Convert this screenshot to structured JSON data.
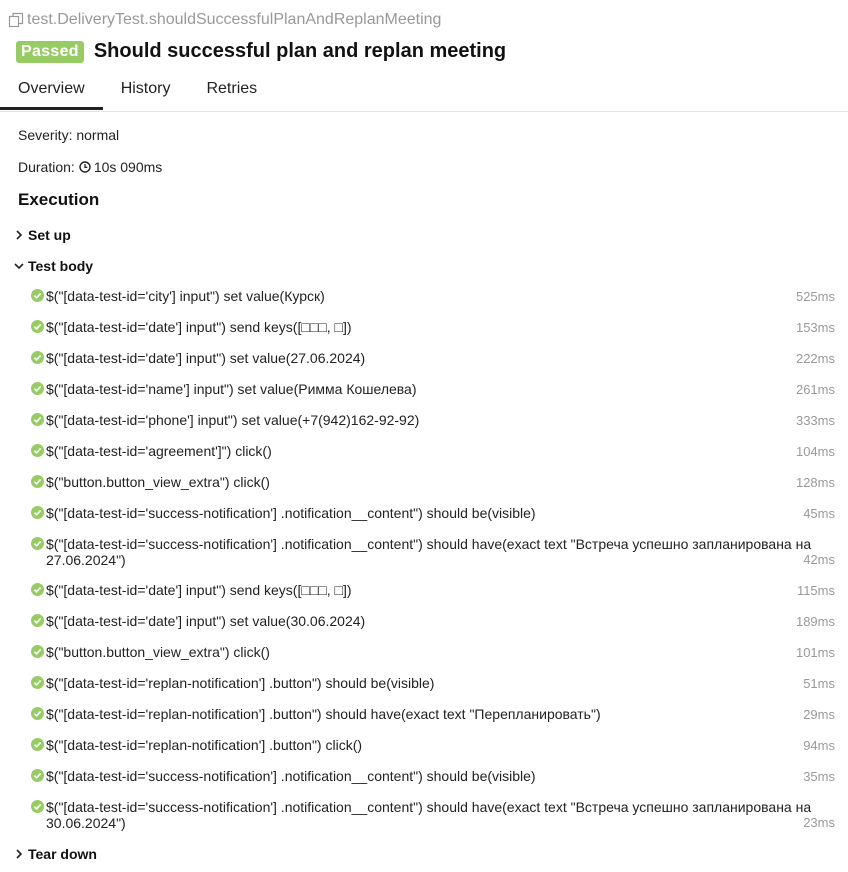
{
  "header": {
    "full_name": "test.DeliveryTest.shouldSuccessfulPlanAndReplanMeeting",
    "status_badge": "Passed",
    "title": "Should successful plan and replan meeting"
  },
  "tabs": [
    {
      "label": "Overview",
      "active": true
    },
    {
      "label": "History",
      "active": false
    },
    {
      "label": "Retries",
      "active": false
    }
  ],
  "severity": {
    "label": "Severity:",
    "value": "normal"
  },
  "duration": {
    "label": "Duration:",
    "value": "10s 090ms"
  },
  "execution": {
    "title": "Execution",
    "set_up_label": "Set up",
    "test_body_label": "Test body",
    "tear_down_label": "Tear down",
    "steps": [
      {
        "name": "$(\"[data-test-id='city'] input\") set value(Курск)",
        "duration": "525ms"
      },
      {
        "name": "$(\"[data-test-id='date'] input\") send keys([□□□, □])",
        "duration": "153ms"
      },
      {
        "name": "$(\"[data-test-id='date'] input\") set value(27.06.2024)",
        "duration": "222ms"
      },
      {
        "name": "$(\"[data-test-id='name'] input\") set value(Римма Кошелева)",
        "duration": "261ms"
      },
      {
        "name": "$(\"[data-test-id='phone'] input\") set value(+7(942)162-92-92)",
        "duration": "333ms"
      },
      {
        "name": "$(\"[data-test-id='agreement']\") click()",
        "duration": "104ms"
      },
      {
        "name": "$(\"button.button_view_extra\") click()",
        "duration": "128ms"
      },
      {
        "name": "$(\"[data-test-id='success-notification'] .notification__content\") should be(visible)",
        "duration": "45ms"
      },
      {
        "name": "$(\"[data-test-id='success-notification'] .notification__content\") should have(exact text \"Встреча успешно запланирована на 27.06.2024\")",
        "duration": "42ms"
      },
      {
        "name": "$(\"[data-test-id='date'] input\") send keys([□□□, □])",
        "duration": "115ms"
      },
      {
        "name": "$(\"[data-test-id='date'] input\") set value(30.06.2024)",
        "duration": "189ms"
      },
      {
        "name": "$(\"button.button_view_extra\") click()",
        "duration": "101ms"
      },
      {
        "name": "$(\"[data-test-id='replan-notification'] .button\") should be(visible)",
        "duration": "51ms"
      },
      {
        "name": "$(\"[data-test-id='replan-notification'] .button\") should have(exact text \"Перепланировать\")",
        "duration": "29ms"
      },
      {
        "name": "$(\"[data-test-id='replan-notification'] .button\") click()",
        "duration": "94ms"
      },
      {
        "name": "$(\"[data-test-id='success-notification'] .notification__content\") should be(visible)",
        "duration": "35ms"
      },
      {
        "name": "$(\"[data-test-id='success-notification'] .notification__content\") should have(exact text \"Встреча успешно запланирована на 30.06.2024\")",
        "duration": "23ms"
      }
    ]
  },
  "icons": {
    "copy": "copy-icon",
    "clock": "clock-icon",
    "passed": "check-circle-icon",
    "chevron_right": "chevron-right-icon",
    "chevron_down": "chevron-down-icon"
  },
  "colors": {
    "passed": "#97cc64",
    "muted": "#999999"
  }
}
